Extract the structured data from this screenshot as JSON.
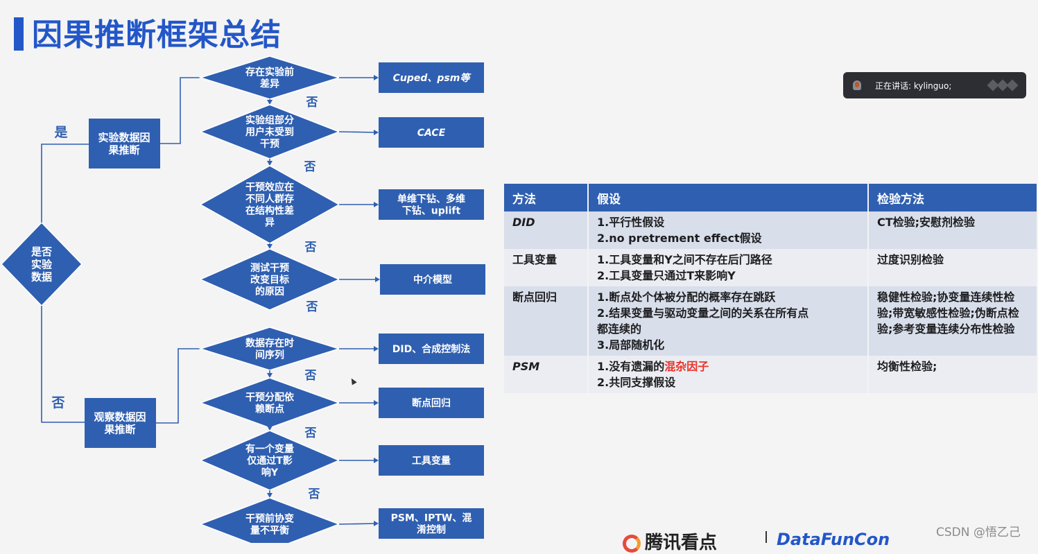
{
  "title": "因果推断框架总结",
  "flow": {
    "root": "是否\n实验\n数据",
    "yes": "是",
    "no": "否",
    "experimental": "实验数据因\n果推断",
    "observational": "观察数据因\n果推断",
    "decisions": [
      "存在实验前\n差异",
      "实验组部分\n用户未受到\n干预",
      "干预效应在\n不同人群存\n在结构性差\n异",
      "测试干预\n改变目标\n的原因",
      "数据存在时\n间序列",
      "干预分配依\n赖断点",
      "有一个变量\n仅通过T影\n响Y",
      "干预前协变\n量不平衡"
    ],
    "methods": [
      "Cuped、psm等",
      "CACE",
      "单维下钻、多维\n下钻、uplift",
      "中介模型",
      "DID、合成控制法",
      "断点回归",
      "工具变量",
      "PSM、IPTW、混\n淆控制"
    ],
    "no_label": "否"
  },
  "speaking": {
    "text": "正在讲话: kylinguo;"
  },
  "table": {
    "headers": [
      "方法",
      "假设",
      "检验方法"
    ],
    "rows": [
      {
        "method": "DID",
        "assumptions": [
          "1.平行性假设",
          "2.no pretrement effect假设"
        ],
        "test": "CT检验;安慰剂检验"
      },
      {
        "method": "工具变量",
        "assumptions": [
          "1.工具变量和Y之间不存在后门路径",
          "2.工具变量只通过T来影响Y"
        ],
        "test": "过度识别检验"
      },
      {
        "method": "断点回归",
        "assumptions": [
          "1.断点处个体被分配的概率存在跳跃",
          "2.结果变量与驱动变量之间的关系在所有点",
          "都连续的",
          "3.局部随机化"
        ],
        "test": "稳健性检验;协变量连续性检验;带宽敏感性检验;伪断点检验;参考变量连续分布性检验"
      },
      {
        "method": "PSM",
        "assumptions_prefix": "1.没有遗漏的",
        "assumptions_highlight": "混杂因子",
        "assumptions_rest": [
          "2.共同支撑假设"
        ],
        "test": "均衡性检验;"
      }
    ]
  },
  "footer": {
    "logo_text": "腾讯看点",
    "blue_text": "DataFunCon",
    "watermark": "CSDN @悟乙己"
  },
  "colors": {
    "primary": "#2f5fb0",
    "title": "#2357c8",
    "highlight": "#e8342a"
  }
}
